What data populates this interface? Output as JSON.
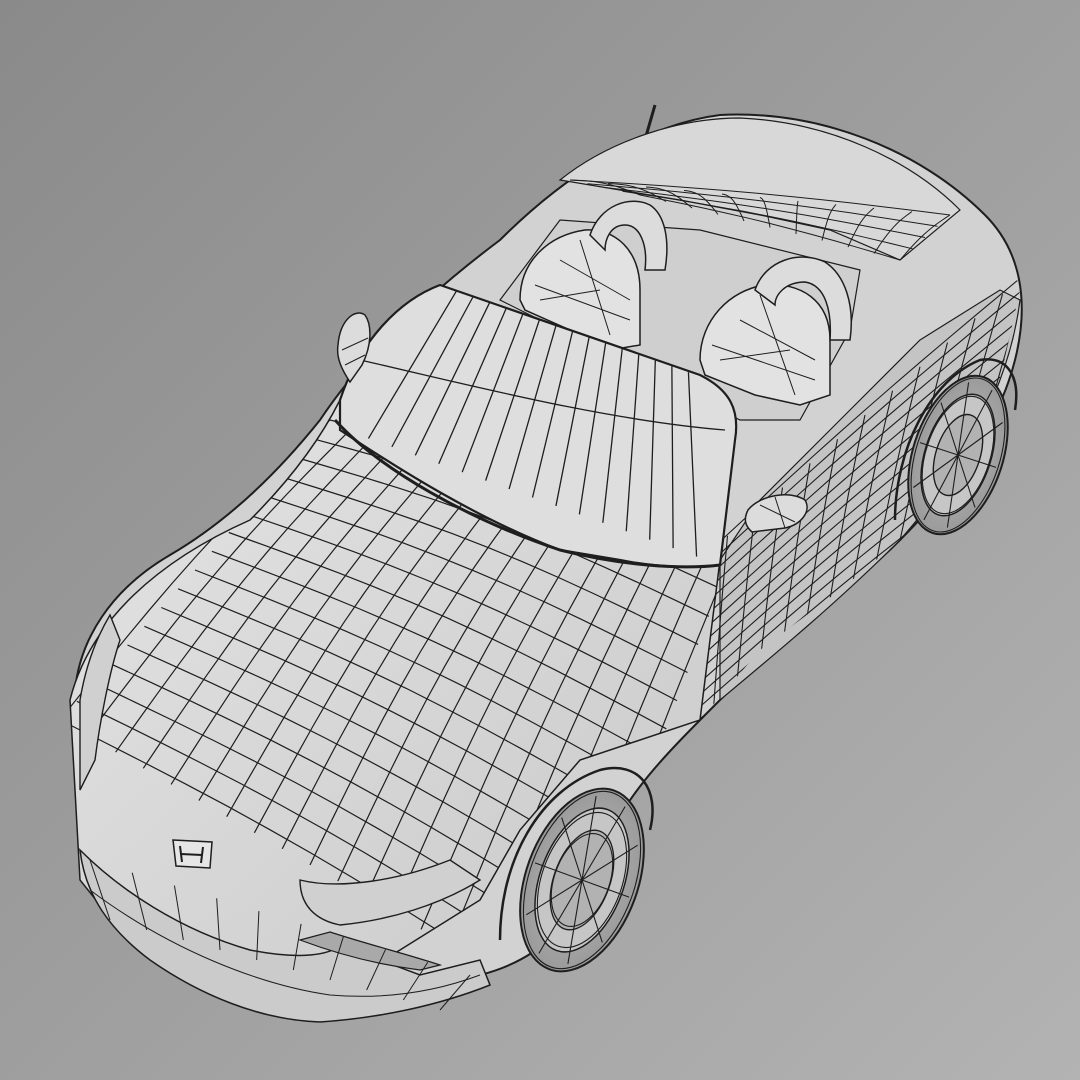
{
  "viewport": {
    "background_top": "#8a8a8a",
    "background_bottom": "#b3b3b3"
  },
  "model": {
    "body_color": "#d6d6d6",
    "shade_color": "#bdbdbd",
    "highlight_color": "#e8e8e8",
    "wire_color": "#1e1e1e",
    "icon": "roadster-car-wireframe"
  }
}
